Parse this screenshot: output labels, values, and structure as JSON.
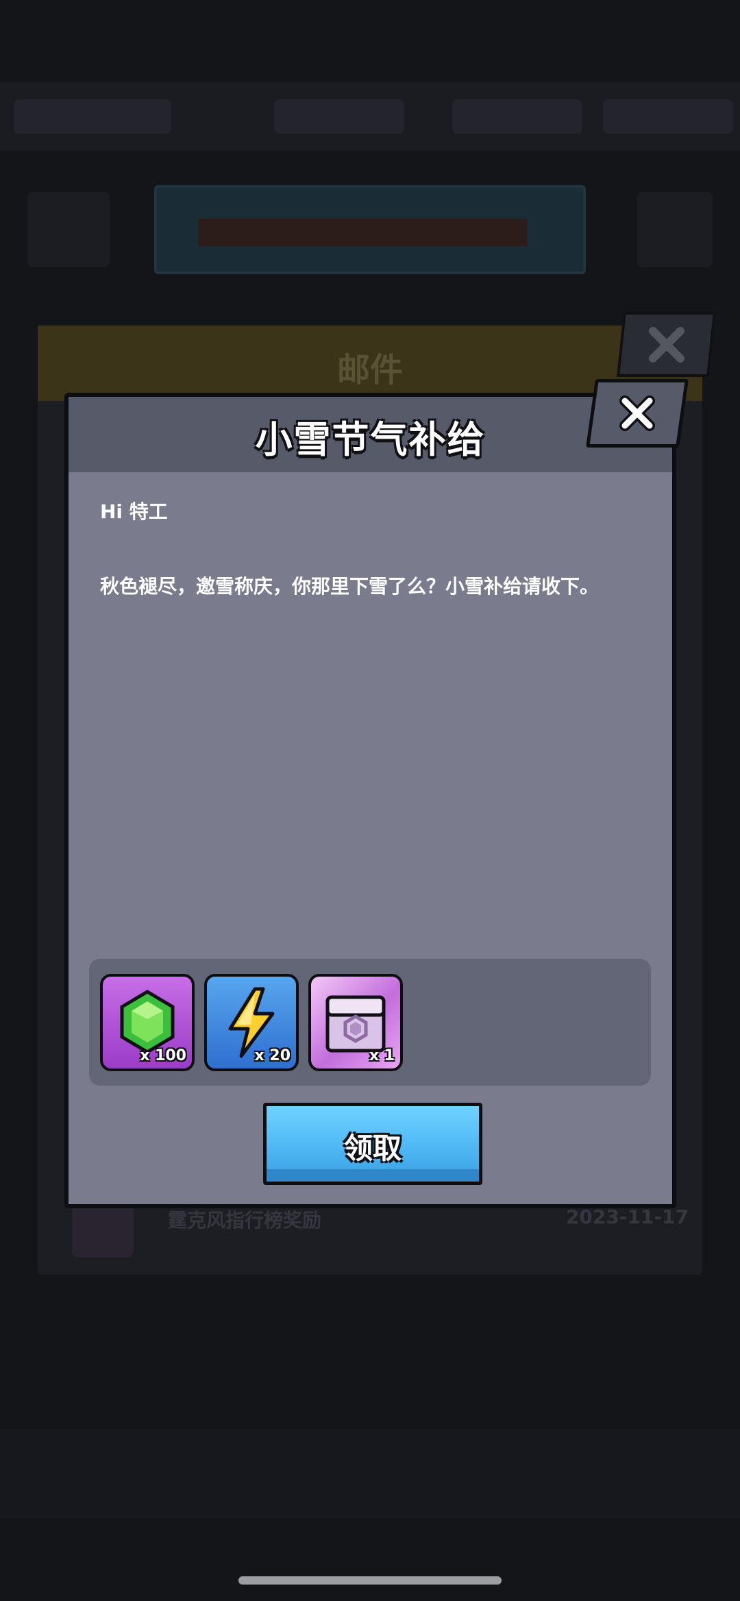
{
  "background": {
    "mail_title": "邮件",
    "row_title": "霆克风指行榜奖励",
    "row_date": "2023-11-17"
  },
  "dialog": {
    "title": "小雪节气补给",
    "greeting": "Hi 特工",
    "message": "秋色褪尽，邀雪称庆，你那里下雪了么？小雪补给请收下。",
    "claim_label": "领取"
  },
  "rewards": [
    {
      "icon": "green-gem-icon",
      "count": "x 100"
    },
    {
      "icon": "energy-lightning-icon",
      "count": "x 20"
    },
    {
      "icon": "chest-icon",
      "count": "x 1"
    }
  ],
  "colors": {
    "dialog_bg": "#7a7c8d",
    "header_bg": "#575a68",
    "claim_button": "#4fb8f4"
  }
}
